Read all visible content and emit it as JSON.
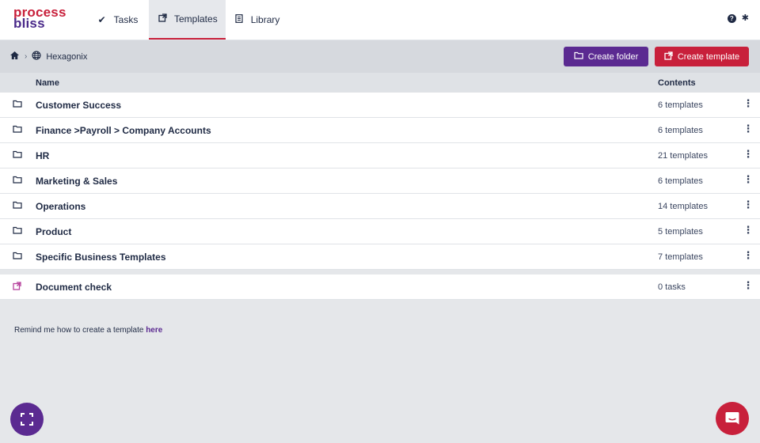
{
  "brand": {
    "line1": "process",
    "line2": "bliss"
  },
  "nav": {
    "tabs": [
      {
        "label": "Tasks",
        "icon": "check-icon"
      },
      {
        "label": "Templates",
        "icon": "template-icon",
        "active": true
      },
      {
        "label": "Library",
        "icon": "library-icon"
      }
    ]
  },
  "breadcrumb": {
    "workspace": "Hexagonix"
  },
  "actions": {
    "create_folder": "Create folder",
    "create_template": "Create template"
  },
  "table": {
    "columns": {
      "name": "Name",
      "contents": "Contents"
    },
    "folders": [
      {
        "name": "Customer Success",
        "contents": "6 templates"
      },
      {
        "name": "Finance >Payroll > Company Accounts",
        "contents": "6 templates"
      },
      {
        "name": "HR",
        "contents": "21 templates"
      },
      {
        "name": "Marketing & Sales",
        "contents": "6 templates"
      },
      {
        "name": "Operations",
        "contents": "14 templates"
      },
      {
        "name": "Product",
        "contents": "5 templates"
      },
      {
        "name": "Specific Business Templates",
        "contents": "7 templates"
      }
    ],
    "templates": [
      {
        "name": "Document check",
        "contents": "0 tasks"
      }
    ]
  },
  "footer": {
    "remind_text": "Remind me how to create a template ",
    "remind_link": "here"
  },
  "colors": {
    "brand_red": "#c8203b",
    "brand_purple": "#5b2a91"
  }
}
